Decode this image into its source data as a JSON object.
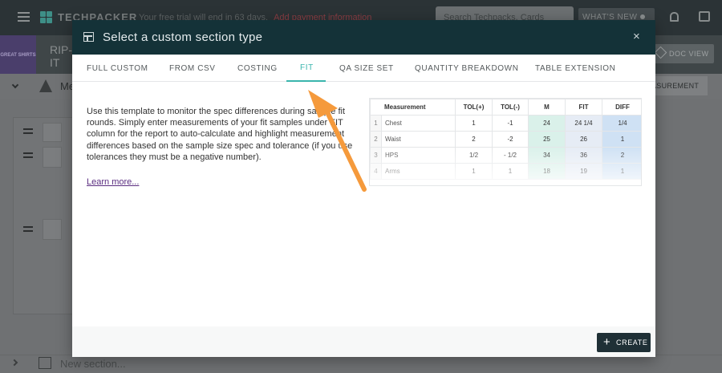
{
  "app": {
    "logo_text": "TECHPACKER",
    "trial_text": "Your free trial will end in 63 days.",
    "trial_link": "Add payment information",
    "search_placeholder": "Search Techpacks, Cards",
    "whats_new_label": "WHAT'S NEW",
    "brand_tile_text": "GREAT SHIRTS",
    "project_title_line1": "RIP-",
    "project_title_line2": "IT",
    "doc_view_label": "DOC VIEW",
    "section_name": "Me",
    "add_measurement_label": "ASUREMENT",
    "new_section_placeholder": "New section..."
  },
  "modal": {
    "title": "Select a custom section type",
    "close_glyph": "×",
    "tabs": [
      {
        "label": "FULL CUSTOM"
      },
      {
        "label": "FROM CSV"
      },
      {
        "label": "COSTING"
      },
      {
        "label": "FIT",
        "active": true
      },
      {
        "label": "QA SIZE SET"
      },
      {
        "label": "QUANTITY BREAKDOWN"
      },
      {
        "label": "TABLE EXTENSION"
      }
    ],
    "description": "Use this template to monitor the spec differences during sample fit rounds. Simply enter measurements of your fit samples under FIT column for the report to auto-calculate and highlight measurement differences based on the sample size spec and tolerance (if you use tolerances they must be a negative number).",
    "learn_more": "Learn more...",
    "create_label": "CREATE",
    "create_icon": "plus-icon",
    "preview": {
      "headers": [
        "Measurement",
        "TOL(+)",
        "TOL(-)",
        "M",
        "FIT",
        "DIFF"
      ],
      "rows": [
        {
          "idx": "1",
          "name": "Chest",
          "tol_plus": "1",
          "tol_minus": "-1",
          "m": "24",
          "fit": "24 1/4",
          "diff": "1/4"
        },
        {
          "idx": "2",
          "name": "Waist",
          "tol_plus": "2",
          "tol_minus": "-2",
          "m": "25",
          "fit": "26",
          "diff": "1"
        },
        {
          "idx": "3",
          "name": "HPS",
          "tol_plus": "1/2",
          "tol_minus": "- 1/2",
          "m": "34",
          "fit": "36",
          "diff": "2"
        },
        {
          "idx": "4",
          "name": "Arms",
          "tol_plus": "1",
          "tol_minus": "1",
          "m": "18",
          "fit": "19",
          "diff": "1"
        }
      ]
    }
  },
  "colors": {
    "accent": "#3ab5ad",
    "modal_header": "#143238",
    "arrow": "#f59a3c",
    "create_button": "#1f3036"
  }
}
